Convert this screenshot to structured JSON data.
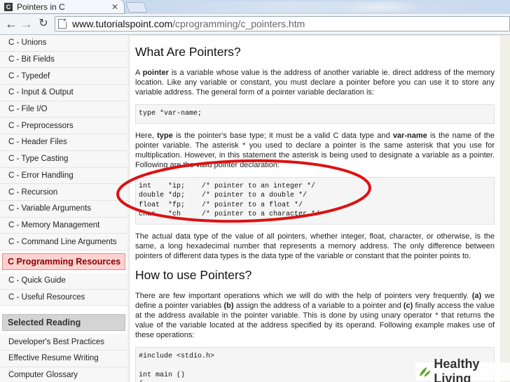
{
  "browser": {
    "tab_title": "Pointers in C",
    "url_host": "www.tutorialspoint.com",
    "url_path": "/cprogramming/c_pointers.htm",
    "favicon_letter": "C"
  },
  "sidebar": {
    "items": [
      "C - Unions",
      "C - Bit Fields",
      "C - Typedef",
      "C - Input & Output",
      "C - File I/O",
      "C - Preprocessors",
      "C - Header Files",
      "C - Type Casting",
      "C - Error Handling",
      "C - Recursion",
      "C - Variable Arguments",
      "C - Memory Management",
      "C - Command Line Arguments"
    ],
    "resources_heading": "C Programming Resources",
    "resources_items": [
      "C - Quick Guide",
      "C - Useful Resources"
    ],
    "reading_heading": "Selected Reading",
    "reading_items": [
      "Developer's Best Practices",
      "Effective Resume Writing",
      "Computer Glossary"
    ]
  },
  "main": {
    "heading1": "What Are Pointers?",
    "para1_a": "A ",
    "para1_b": "pointer",
    "para1_c": " is a variable whose value is the address of another variable ie. direct address of the memory location. Like any variable or constant, you must declare a pointer before you can use it to store any variable address. The general form of a pointer variable declaration is:",
    "code1": "type *var-name;",
    "para2_a": "Here, ",
    "para2_b": "type",
    "para2_c": " is the pointer's base type; it must be a valid C data type and ",
    "para2_d": "var-name",
    "para2_e": " is the name of the pointer variable. The asterisk * you used to declare a pointer is the same asterisk that you use for multiplication. However, in this statement the asterisk is being used to designate a variable as a pointer. Following are the valid pointer declaration:",
    "code2": [
      "int    *ip;    /* pointer to an integer */",
      "double *dp;    /* pointer to a double */",
      "float  *fp;    /* pointer to a float */",
      "char   *ch     /* pointer to a character */"
    ],
    "para3": "The actual data type of the value of all pointers, whether integer, float, character, or otherwise, is the same, a long hexadecimal number that represents a memory address. The only difference between pointers of different data types is the data type of the variable or constant that the pointer points to.",
    "heading2": "How to use Pointers?",
    "para4_a": "There are few important operations which we will do with the help of pointers very frequently. ",
    "para4_b": "(a)",
    "para4_c": " we define a pointer variables ",
    "para4_d": "(b)",
    "para4_e": " assign the address of a variable to a pointer and ",
    "para4_f": "(c)",
    "para4_g": " finally access the value at the address available in the pointer variable. This is done by using unary operator * that returns the value of the variable located at the address specified by its operand. Following example makes use of these operations:",
    "code3": [
      "#include <stdio.h>",
      "",
      "int main ()",
      "{"
    ]
  },
  "watermark": {
    "text": "Healthy Living"
  },
  "colors": {
    "annotation_ellipse": "#d11",
    "resources_heading": "#8a0000",
    "watermark_logo": "#5aa51e"
  }
}
